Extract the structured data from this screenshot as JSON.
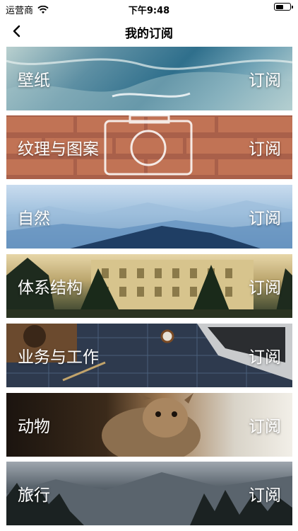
{
  "status_bar": {
    "carrier": "运营商",
    "time": "下午9:48",
    "battery_level": 0.6
  },
  "nav": {
    "title": "我的订阅",
    "back_icon": "chevron-left-icon"
  },
  "cards": [
    {
      "label": "壁纸",
      "action": "订阅"
    },
    {
      "label": "纹理与图案",
      "action": "订阅"
    },
    {
      "label": "自然",
      "action": "订阅"
    },
    {
      "label": "体系结构",
      "action": "订阅"
    },
    {
      "label": "业务与工作",
      "action": "订阅"
    },
    {
      "label": "动物",
      "action": "订阅"
    },
    {
      "label": "旅行",
      "action": "订阅"
    }
  ]
}
